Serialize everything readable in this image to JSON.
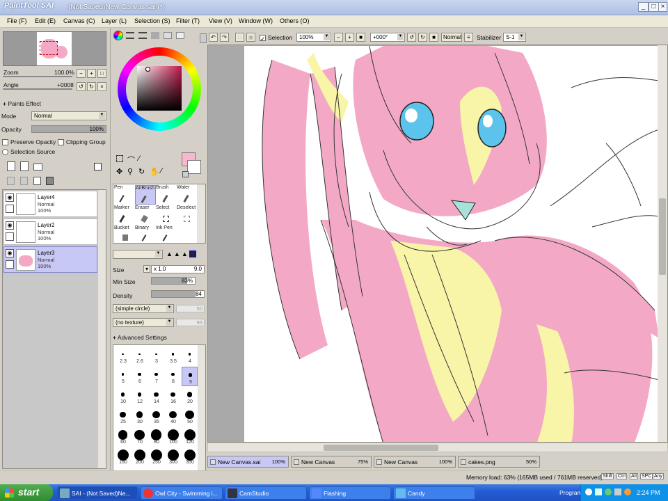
{
  "window": {
    "logo": "PaintTool SAI",
    "title": "(Not Saved)New Canvas.sai (*)",
    "controls": [
      "_",
      "□",
      "×"
    ]
  },
  "menu": [
    "File (F)",
    "Edit (E)",
    "Canvas (C)",
    "Layer (L)",
    "Selection (S)",
    "Filter (T)",
    "View (V)",
    "Window (W)",
    "Others (O)"
  ],
  "navigator": {
    "zoom_label": "Zoom",
    "zoom_value": "100.0%",
    "angle_label": "Angle",
    "angle_value": "+0008"
  },
  "layer_props": {
    "paints_effect": "Paints Effect",
    "mode_label": "Mode",
    "mode_value": "Normal",
    "opacity_label": "Opacity",
    "opacity_value": "100%",
    "opacity_level": 1.0,
    "preserve_opacity": "Preserve Opacity",
    "clipping_group": "Clipping Group",
    "selection_source": "Selection Source"
  },
  "layers": [
    {
      "name": "Layer4",
      "mode": "Normal",
      "opacity": "100%",
      "selected": false
    },
    {
      "name": "Layer2",
      "mode": "Normal",
      "opacity": "100%",
      "selected": false
    },
    {
      "name": "Layer3",
      "mode": "Normal",
      "opacity": "100%",
      "selected": true
    }
  ],
  "tools": [
    {
      "name": "Pen"
    },
    {
      "name": "AirBrush"
    },
    {
      "name": "Brush"
    },
    {
      "name": "Water"
    },
    {
      "name": "Marker"
    },
    {
      "name": "Eraser"
    },
    {
      "name": "Select"
    },
    {
      "name": "Deselect"
    },
    {
      "name": "Bucket"
    },
    {
      "name": "Binary"
    },
    {
      "name": "Ink Pen"
    }
  ],
  "brush": {
    "blend_mode": "Normal",
    "size_label": "Size",
    "size_mult": "x 1.0",
    "size_value": "9.0",
    "min_size_label": "Min Size",
    "min_size_value": "83%",
    "min_size_level": 0.83,
    "density_label": "Density",
    "density_value": "84",
    "density_level": 0.84,
    "shape": "(simple circle)",
    "shape_value": "50",
    "texture": "(no texture)",
    "texture_value": "95",
    "advanced": "Advanced Settings",
    "size_presets": [
      "2.3",
      "2.6",
      "3",
      "3.5",
      "4",
      "5",
      "6",
      "7",
      "8",
      "9",
      "10",
      "12",
      "14",
      "16",
      "20",
      "25",
      "30",
      "35",
      "40",
      "50",
      "60",
      "70",
      "80",
      "100",
      "120",
      "160",
      "200",
      "250",
      "300",
      "350"
    ],
    "selected_preset": "9"
  },
  "toolbar": {
    "selection_label": "Selection",
    "zoom_value": "100%",
    "angle_value": "+000°",
    "blend_value": "Normal",
    "stabilizer_label": "Stabilizer",
    "stabilizer_value": "S-1"
  },
  "canvas_tabs": [
    {
      "name": "New Canvas.sai",
      "zoom": "100%",
      "active": true
    },
    {
      "name": "New Canvas",
      "zoom": "75%",
      "active": false
    },
    {
      "name": "New Canvas",
      "zoom": "100%",
      "active": false
    },
    {
      "name": "cakes.png",
      "zoom": "50%",
      "active": false
    }
  ],
  "status": {
    "memory": "Memory load: 63% (165MB used / 761MB reserved)",
    "keys": [
      "Shift",
      "Ctrl",
      "Alt",
      "SPC",
      "Any"
    ]
  },
  "taskbar": {
    "start": "start",
    "tasks": [
      {
        "label": "SAI - (Not Saved)Ne...",
        "active": true
      },
      {
        "label": "Owl City - Swimming i...",
        "active": false
      },
      {
        "label": "CamStudio",
        "active": false
      },
      {
        "label": "Flashing",
        "active": false
      },
      {
        "label": "Candy",
        "active": false
      }
    ],
    "programs": "Programs",
    "clock": "2:24 PM"
  },
  "colors": {
    "selected_color": "#f5b8cc",
    "canvas_pink": "#f3a9c6",
    "canvas_yellow": "#f8f4a8",
    "eye_blue": "#5cc3ec"
  }
}
